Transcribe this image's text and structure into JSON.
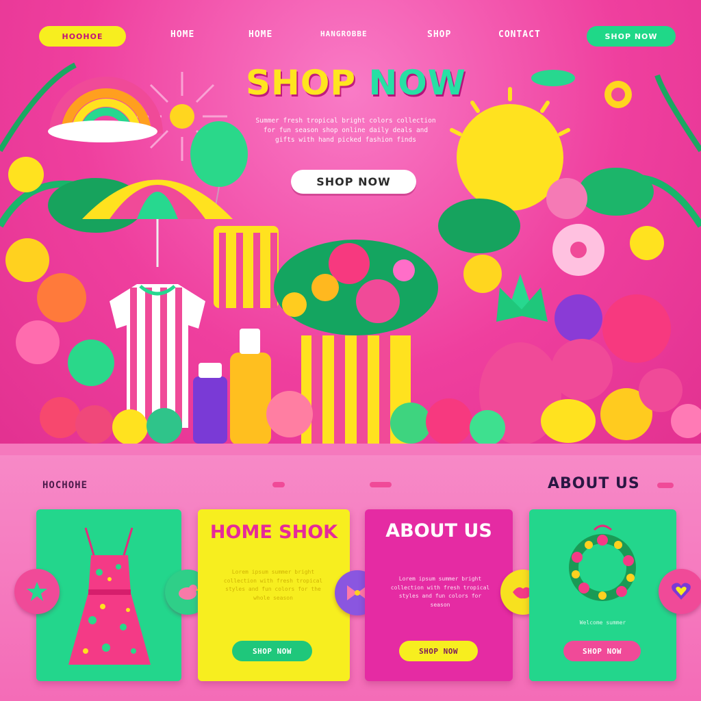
{
  "nav": {
    "logo_label": "HOOHOE",
    "links": [
      "HOME",
      "HOME",
      "HANGROBBE",
      "SHOP",
      "CONTACT"
    ],
    "cta_label": "SHOP NOW"
  },
  "hero": {
    "title_word1": "SHOP",
    "title_word2": "NOW",
    "paragraph": "Summer fresh tropical bright colors collection for fun season shop online daily deals and gifts with hand picked fashion finds",
    "button_label": "SHOP NOW"
  },
  "sections": {
    "left_label": "HOCHOHE",
    "right_label": "ABOUT US"
  },
  "cards": [
    {
      "title": "",
      "text": "",
      "button": ""
    },
    {
      "title": "HOME SHOK",
      "text": "Lorem ipsum summer bright collection with fresh tropical styles and fun colors for the whole season",
      "button": "SHOP NOW"
    },
    {
      "title": "ABOUT US",
      "text": "Lorem ipsum summer bright collection with fresh tropical styles and fun colors for season",
      "button": "SHOP NOW"
    },
    {
      "title": "",
      "text": "Welcome summer",
      "button": "SHOP NOW"
    }
  ],
  "colors": {
    "pink": "#f04a98",
    "yellow": "#f7ee1f",
    "green": "#1fd888",
    "magenta": "#e52ba3",
    "purple": "#7a3ad6"
  },
  "icons": [
    "star-icon",
    "bird-icon",
    "bow-icon",
    "lips-icon",
    "heart-icon"
  ]
}
